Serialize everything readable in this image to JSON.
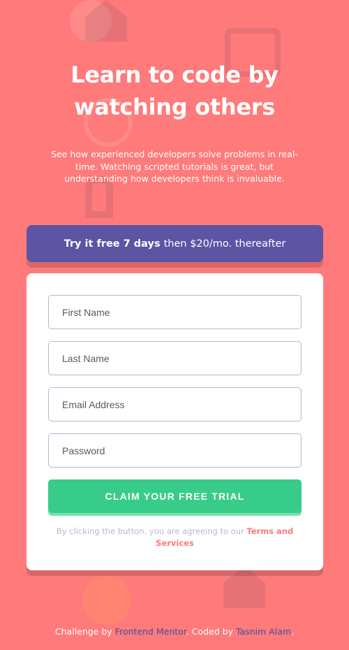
{
  "hero": {
    "title": "Learn to code by watching others",
    "description": "See how experienced developers solve problems in real-time. Watching scripted tutorials is great, but understanding how developers think is invaluable."
  },
  "offer": {
    "bold": "Try it free 7 days",
    "rest": "then $20/mo. thereafter"
  },
  "form": {
    "first_name_placeholder": "First Name",
    "last_name_placeholder": "Last Name",
    "email_placeholder": "Email Address",
    "password_placeholder": "Password",
    "submit_label": "CLAIM YOUR FREE TRIAL",
    "terms_prefix": "By clicking the button, you are agreeing to our",
    "terms_link": "Terms and Services"
  },
  "attribution": {
    "prefix": "Challenge by",
    "mentor_link": "Frontend Mentor",
    "middle": ". Coded by",
    "author_link": "Tasnim Alam",
    "suffix": "."
  },
  "colors": {
    "background": "#FF7A7A",
    "offer_bg": "#5E54A4",
    "cta_bg": "#38CC8B",
    "terms_link": "#FF7A7A"
  }
}
